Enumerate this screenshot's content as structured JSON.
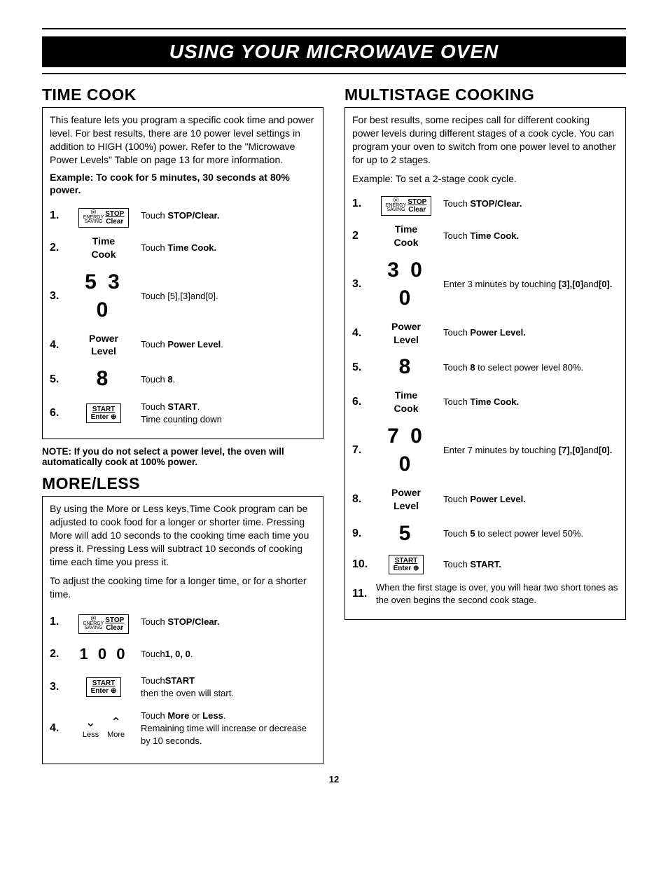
{
  "banner": "USING YOUR MICROWAVE OVEN",
  "page_number": "12",
  "btn": {
    "stop_top": "STOP",
    "stop_bot": "Clear",
    "energy": "ENERGY\nSAVING",
    "e": "e",
    "start_top": "START",
    "start_bot": "Enter ⊕"
  },
  "labels": {
    "time_cook": "Time\nCook",
    "power_level": "Power\nLevel",
    "less": "Less",
    "more": "More"
  },
  "tc": {
    "heading": "TIME COOK",
    "intro": "This feature lets you program a specific cook time and power level. For best results, there are 10 power level settings in addition to HIGH (100%) power. Refer to the \"Microwave Power Levels\" Table on page 13 for more information.",
    "example": "Example: To cook for 5 minutes, 30 seconds at 80% power.",
    "note": "NOTE: If you do not select a power level, the oven will automatically cook at 100% power.",
    "steps": [
      {
        "n": "1.",
        "icon": "stop",
        "d_pre": "Touch ",
        "d_b": "STOP/Clear."
      },
      {
        "n": "2.",
        "icon": "timecook",
        "d_pre": "Touch ",
        "d_b": "Time Cook."
      },
      {
        "n": "3.",
        "icon": "530",
        "d_plain": "Touch [5],[3]and[0]."
      },
      {
        "n": "4.",
        "icon": "power",
        "d_pre": "Touch ",
        "d_b": "Power Level",
        "d_post": "."
      },
      {
        "n": "5.",
        "icon": "8",
        "d_pre": "Touch ",
        "d_b": "8",
        "d_post": "."
      },
      {
        "n": "6.",
        "icon": "start",
        "d_pre": "Touch ",
        "d_b": "START",
        "d_post": ".",
        "d_line2": "Time counting down"
      }
    ]
  },
  "ml": {
    "heading": "MORE/LESS",
    "p1": "By using the More or Less keys,Time Cook program can be adjusted to cook food for a longer or shorter time. Pressing More will add 10 seconds to the cooking time each time you press it. Pressing Less will subtract 10 seconds of cooking time each time you press it.",
    "p2": "To adjust the cooking time for a longer time, or for a shorter time.",
    "steps": [
      {
        "n": "1.",
        "icon": "stop",
        "d_pre": "Touch ",
        "d_b": "STOP/Clear."
      },
      {
        "n": "2.",
        "icon": "100",
        "d_pre": "Touch",
        "d_b": "1, 0, 0",
        "d_post": "."
      },
      {
        "n": "3.",
        "icon": "start",
        "d_pre": "Touch",
        "d_b": "START",
        "d_line2": "then the oven will start."
      },
      {
        "n": "4.",
        "icon": "moreless",
        "d_pre": "Touch",
        "d_b": " More ",
        "d_mid": "or ",
        "d_b2": "Less",
        "d_post": ".",
        "d_line2": "Remaining time will increase or decrease by 10 seconds."
      }
    ]
  },
  "ms": {
    "heading": "MULTISTAGE COOKING",
    "intro": "For best results, some recipes call for different cooking power levels during different stages of a cook cycle. You can program your oven to switch from one power level to another for up to 2 stages.",
    "example": "Example: To set a 2-stage cook cycle.",
    "steps": [
      {
        "n": "1.",
        "icon": "stop",
        "d_pre": "Touch ",
        "d_b": "STOP/Clear."
      },
      {
        "n": "2",
        "icon": "timecook",
        "d_pre": "Touch ",
        "d_b": "Time Cook."
      },
      {
        "n": "3.",
        "icon": "300",
        "d_pre": "Enter 3 minutes by touching ",
        "d_b": "[3],[0]",
        "d_mid": "and",
        "d_b2": "[0]."
      },
      {
        "n": "4.",
        "icon": "power",
        "d_pre": "Touch ",
        "d_b": "Power Level."
      },
      {
        "n": "5.",
        "icon": "8",
        "d_pre": "Touch ",
        "d_b": "8",
        "d_post": " to select power level 80%."
      },
      {
        "n": "6.",
        "icon": "timecook",
        "d_pre": "Touch ",
        "d_b": "Time Cook."
      },
      {
        "n": "7.",
        "icon": "700",
        "d_pre": "Enter 7 minutes by touching ",
        "d_b": "[7],[0]",
        "d_mid": "and",
        "d_b2": "[0]."
      },
      {
        "n": "8.",
        "icon": "power",
        "d_pre": "Touch ",
        "d_b": "Power Level."
      },
      {
        "n": "9.",
        "icon": "5",
        "d_pre": "Touch ",
        "d_b": "5",
        "d_post": " to select power level 50%."
      },
      {
        "n": "10.",
        "icon": "start",
        "d_pre": "Touch ",
        "d_b": "START."
      },
      {
        "n": "11.",
        "full": "When the first stage is over, you will hear two short tones as the oven begins the second cook stage."
      }
    ]
  }
}
